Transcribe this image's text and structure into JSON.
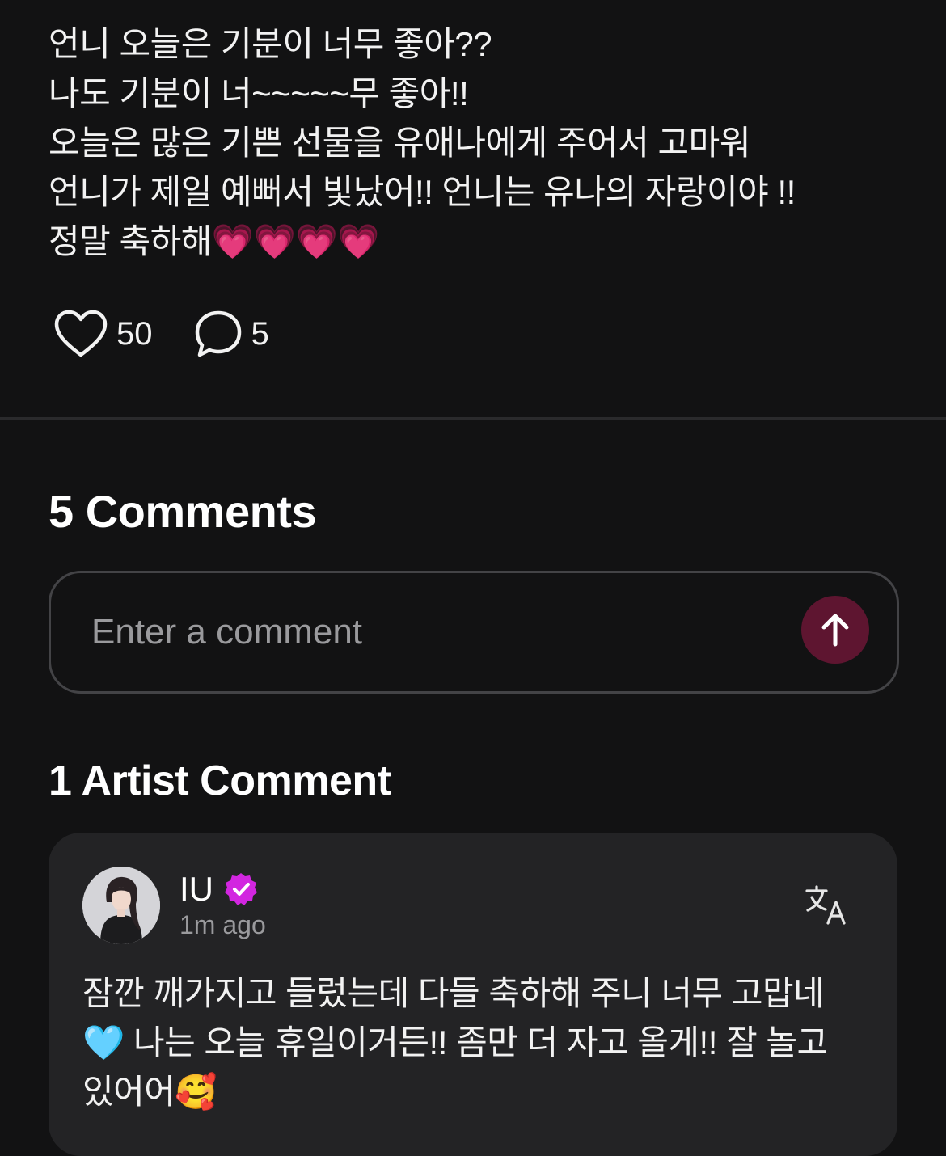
{
  "post": {
    "lines": [
      "언니 오늘은 기분이 너무 좋아??",
      "나도 기분이 너~~~~~무 좋아!!",
      "오늘은 많은 기쁜 선물을 유애나에게 주어서 고마워",
      "언니가 제일 예뻐서 빛났어!! 언니는 유나의 자랑이야 !!",
      "정말 축하해💗💗💗💗"
    ],
    "like_count": "50",
    "comment_count": "5"
  },
  "comments_section": {
    "title": "5 Comments",
    "input_placeholder": "Enter a comment"
  },
  "artist_section": {
    "title": "1 Artist Comment",
    "comment": {
      "author": "IU",
      "timestamp": "1m ago",
      "text_lines": [
        "잠깐 깨가지고 들렀는데 다들 축하해 주니 너무 고맙네",
        "🩵 나는 오늘 휴일이거든!! 좀만 더 자고 올게!! 잘 놀고",
        "있어어🥰"
      ]
    }
  },
  "colors": {
    "background": "#121213",
    "card": "#232325",
    "send_button": "#5e1530",
    "verified_badge": "#d226e0"
  },
  "icons": [
    "heart-icon",
    "speech-bubble-icon",
    "arrow-up-icon",
    "verified-badge-icon",
    "translate-icon"
  ]
}
